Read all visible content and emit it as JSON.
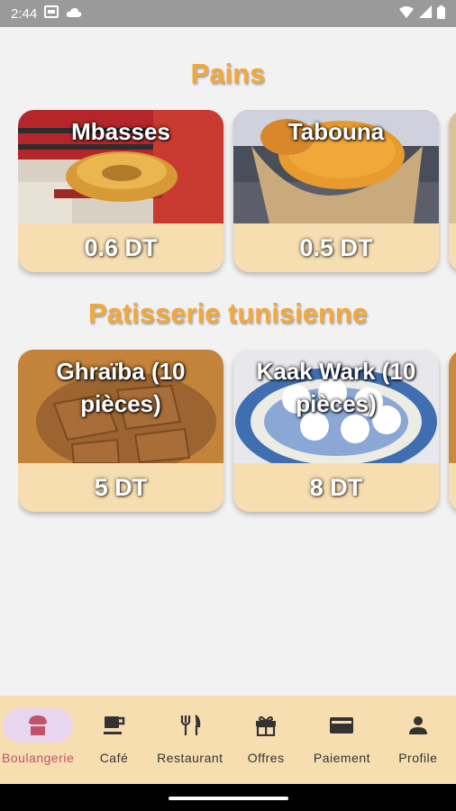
{
  "status": {
    "time": "2:44"
  },
  "sections": [
    {
      "title": "Pains",
      "items": [
        {
          "name": "Mbasses",
          "price": "0.6 DT"
        },
        {
          "name": "Tabouna",
          "price": "0.5 DT"
        }
      ]
    },
    {
      "title": "Patisserie tunisienne",
      "items": [
        {
          "name": "Ghraïba (10 pièces)",
          "price": "5 DT"
        },
        {
          "name": "Kaak Wark (10 pièces)",
          "price": "8 DT"
        }
      ]
    }
  ],
  "nav": [
    {
      "label": "Boulangerie",
      "icon": "bakery-icon",
      "active": true
    },
    {
      "label": "Café",
      "icon": "coffee-icon"
    },
    {
      "label": "Restaurant",
      "icon": "fork-knife-icon"
    },
    {
      "label": "Offres",
      "icon": "gift-icon"
    },
    {
      "label": "Paiement",
      "icon": "credit-card-icon"
    },
    {
      "label": "Profile",
      "icon": "person-icon"
    }
  ],
  "colors": {
    "accent": "#f2a83a",
    "card": "#f6deb0",
    "nav_active": "#e8d6ee",
    "nav_active_text": "#c0526a"
  }
}
